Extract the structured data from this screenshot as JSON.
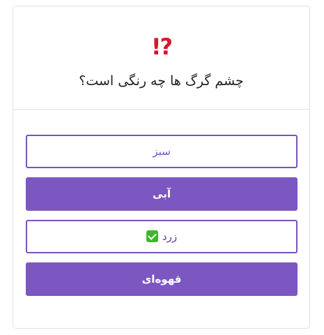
{
  "header": {
    "icon_text": "⁉",
    "icon_name": "exclamation-question-icon",
    "question": "چشم گرگ ها چه رنگی است؟"
  },
  "options": [
    {
      "label": "سبز",
      "style": "outline",
      "correct": false
    },
    {
      "label": "آبی",
      "style": "filled",
      "correct": false
    },
    {
      "label": "زرد",
      "style": "outline",
      "correct": true
    },
    {
      "label": "قهوه‌ای",
      "style": "filled",
      "correct": false
    }
  ],
  "colors": {
    "accent": "#7c57c1",
    "header_icon": "#d6182b",
    "check": "#3fb62c"
  }
}
